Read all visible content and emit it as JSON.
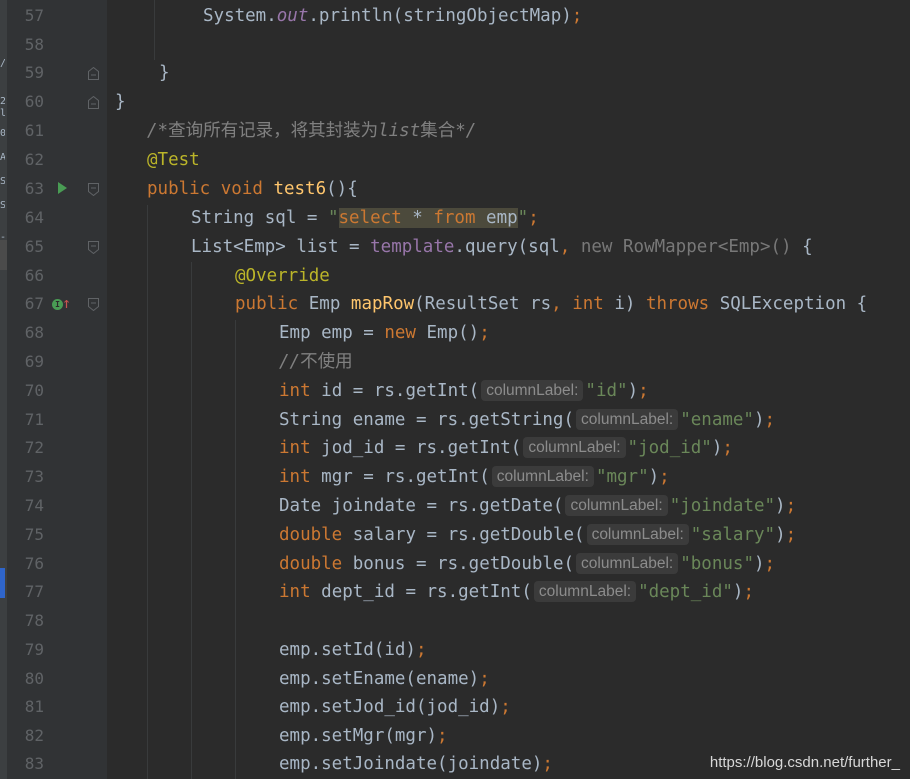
{
  "line_numbers": [
    "57",
    "58",
    "59",
    "60",
    "61",
    "62",
    "63",
    "64",
    "65",
    "66",
    "67",
    "68",
    "69",
    "70",
    "71",
    "72",
    "73",
    "74",
    "75",
    "76",
    "77",
    "78",
    "79",
    "80",
    "81",
    "82",
    "83"
  ],
  "code": {
    "l57": {
      "a": "System.",
      "b": "out",
      "c": ".println(stringObjectMap)",
      "d": ";"
    },
    "l59": {
      "a": "}"
    },
    "l60": {
      "a": "}"
    },
    "l61": {
      "a": "/*",
      "b": "查询所有记录，将其封装为",
      "c": "list",
      "d": "集合",
      "e": "*/"
    },
    "l62": {
      "a": "@Test"
    },
    "l63": {
      "a": "public void ",
      "b": "test6",
      "c": "(){"
    },
    "l64": {
      "a": "String sql = ",
      "b": "\"",
      "c": "select",
      "d": " * ",
      "e": "from",
      "f": " emp",
      "g": "\"",
      "h": ";"
    },
    "l65": {
      "a": "List<Emp> list = ",
      "b": "template",
      "c": ".query(sql",
      "d": ", ",
      "e": "new RowMapper<Emp>()",
      "f": " {"
    },
    "l66": {
      "a": "@Override"
    },
    "l67": {
      "a": "public ",
      "b": "Emp ",
      "c": "mapRow",
      "d": "(ResultSet rs",
      "e": ", ",
      "f": "int ",
      "g": "i) ",
      "h": "throws ",
      "i": "SQLException {"
    },
    "l68": {
      "a": "Emp emp = ",
      "b": "new ",
      "c": "Emp()",
      "d": ";"
    },
    "l69": {
      "a": "//",
      "b": "不使用"
    },
    "l70": {
      "a": "int ",
      "b": "id = rs.getInt(",
      "hint": "columnLabel:",
      "c": "\"id\"",
      "d": ")",
      "e": ";"
    },
    "l71": {
      "a": "String ename = rs.getString(",
      "hint": "columnLabel:",
      "c": "\"ename\"",
      "d": ")",
      "e": ";"
    },
    "l72": {
      "a": "int ",
      "b": "jod_id = rs.getInt(",
      "hint": "columnLabel:",
      "c": "\"jod_id\"",
      "d": ")",
      "e": ";"
    },
    "l73": {
      "a": "int ",
      "b": "mgr = rs.getInt(",
      "hint": "columnLabel:",
      "c": "\"mgr\"",
      "d": ")",
      "e": ";"
    },
    "l74": {
      "a": "Date joindate = rs.getDate(",
      "hint": "columnLabel:",
      "c": "\"joindate\"",
      "d": ")",
      "e": ";"
    },
    "l75": {
      "a": "double ",
      "b": "salary = rs.getDouble(",
      "hint": "columnLabel:",
      "c": "\"salary\"",
      "d": ")",
      "e": ";"
    },
    "l76": {
      "a": "double ",
      "b": "bonus = rs.getDouble(",
      "hint": "columnLabel:",
      "c": "\"bonus\"",
      "d": ")",
      "e": ";"
    },
    "l77": {
      "a": "int ",
      "b": "dept_id = rs.getInt(",
      "hint": "columnLabel:",
      "c": "\"dept_id\"",
      "d": ")",
      "e": ";"
    },
    "l79": {
      "a": "emp.setId(id)",
      "b": ";"
    },
    "l80": {
      "a": "emp.setEname(ename)",
      "b": ";"
    },
    "l81": {
      "a": "emp.setJod_id(jod_id)",
      "b": ";"
    },
    "l82": {
      "a": "emp.setMgr(mgr)",
      "b": ";"
    },
    "l83": {
      "a": "emp.setJoindate(joindate)",
      "b": ";"
    }
  },
  "watermark": "https://blog.csdn.net/further_",
  "left_strip_chars": [
    "/",
    "2",
    "l",
    "0",
    "A",
    "S",
    "S",
    "-"
  ],
  "icons": {
    "run": "run-gutter-icon",
    "implements": "implements-method-icon",
    "override_up": "override-up-arrow-icon",
    "fold": "fold-marker-icon"
  },
  "colors": {
    "background": "#2b2b2b",
    "gutter": "#313335",
    "keyword": "#cc7832",
    "method": "#ffc66d",
    "string": "#6a8759",
    "annotation": "#bbb529",
    "field": "#9876aa",
    "comment": "#808080",
    "text": "#a9b7c6"
  }
}
